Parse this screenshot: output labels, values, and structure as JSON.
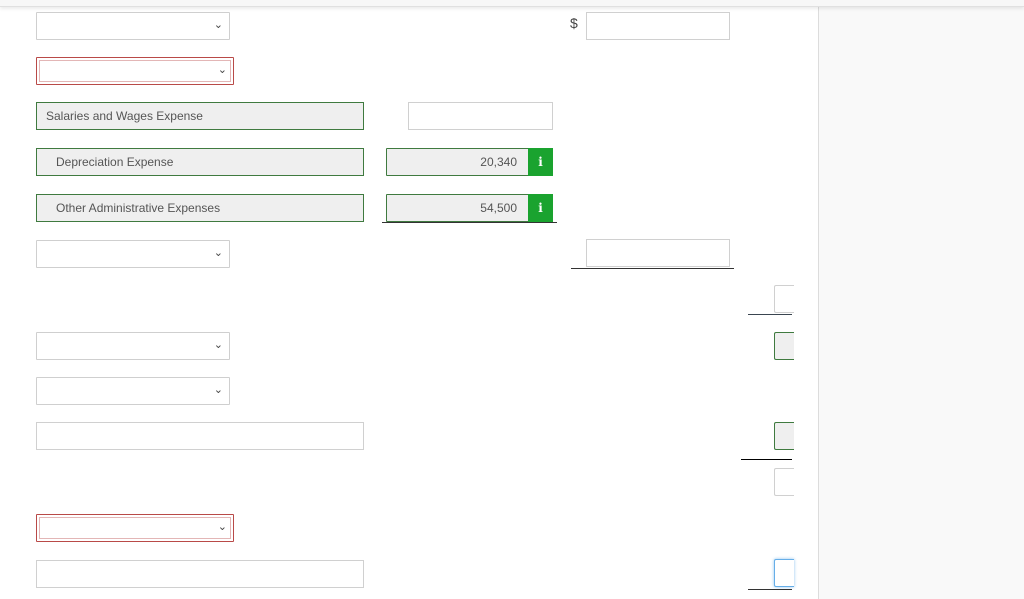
{
  "form": {
    "currency_symbol": "$",
    "rows": [
      {
        "type": "select",
        "value": "",
        "state": "normal"
      },
      {
        "type": "select",
        "value": "",
        "state": "error"
      },
      {
        "type": "account",
        "label": "Salaries and Wages Expense",
        "amount": ""
      },
      {
        "type": "account",
        "label": "Depreciation Expense",
        "amount": "20,340",
        "info": "i"
      },
      {
        "type": "account",
        "label": "Other Administrative Expenses",
        "amount": "54,500",
        "info": "i"
      },
      {
        "type": "select",
        "value": "",
        "state": "normal"
      },
      {
        "type": "select",
        "value": "",
        "state": "normal"
      },
      {
        "type": "select",
        "value": "",
        "state": "normal"
      },
      {
        "type": "text",
        "value": ""
      },
      {
        "type": "select",
        "value": "",
        "state": "error"
      },
      {
        "type": "text",
        "value": ""
      }
    ],
    "info_icon_glyph": "i",
    "chevron_glyph": "⌄"
  },
  "colors": {
    "correct_border": "#3f7a3f",
    "error_border": "#b94a48",
    "info_button": "#1aa32f",
    "focus_border": "#66aee8"
  }
}
